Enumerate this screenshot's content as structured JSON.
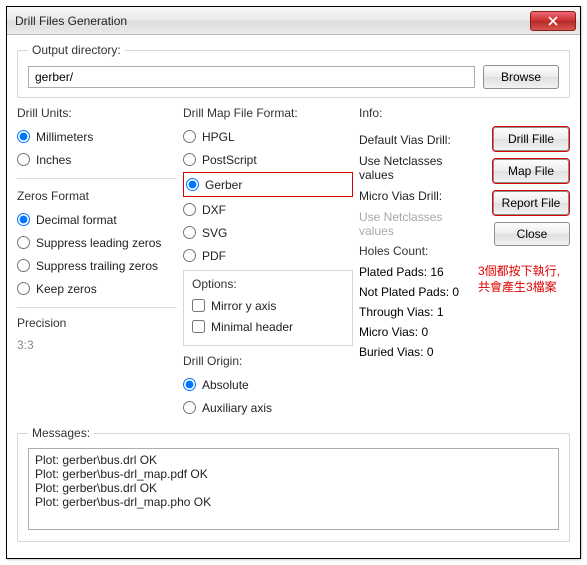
{
  "window": {
    "title": "Drill Files Generation"
  },
  "output": {
    "label": "Output directory:",
    "value": "gerber/",
    "browse": "Browse"
  },
  "drillUnits": {
    "label": "Drill Units:",
    "mm": "Millimeters",
    "in": "Inches"
  },
  "zeros": {
    "label": "Zeros Format",
    "decimal": "Decimal format",
    "supLead": "Suppress leading zeros",
    "supTrail": "Suppress trailing zeros",
    "keep": "Keep zeros"
  },
  "precision": {
    "label": "Precision",
    "value": "3:3"
  },
  "mapFmt": {
    "label": "Drill Map File Format:",
    "hpgl": "HPGL",
    "ps": "PostScript",
    "gerber": "Gerber",
    "dxf": "DXF",
    "svg": "SVG",
    "pdf": "PDF"
  },
  "options": {
    "label": "Options:",
    "mirror": "Mirror y axis",
    "minhdr": "Minimal header"
  },
  "origin": {
    "label": "Drill Origin:",
    "abs": "Absolute",
    "aux": "Auxiliary axis"
  },
  "info": {
    "label": "Info:",
    "defVias": "Default Vias Drill:",
    "useNet": "Use Netclasses values",
    "microVias": "Micro Vias Drill:",
    "useNet2": "Use Netclasses values"
  },
  "buttons": {
    "drill": "Drill Fille",
    "map": "Map File",
    "report": "Report File",
    "close": "Close"
  },
  "holes": {
    "label": "Holes Count:",
    "plated": "Plated Pads: 16",
    "notPlated": "Not Plated Pads: 0",
    "through": "Through Vias: 1",
    "micro": "Micro Vias: 0",
    "buried": "Buried Vias: 0"
  },
  "annotation": {
    "l1": "3個都按下執行,",
    "l2": "共會產生3檔案"
  },
  "messages": {
    "label": "Messages:",
    "text": "Plot: gerber\\bus.drl OK\nPlot: gerber\\bus-drl_map.pdf OK\nPlot: gerber\\bus.drl OK\nPlot: gerber\\bus-drl_map.pho OK"
  }
}
